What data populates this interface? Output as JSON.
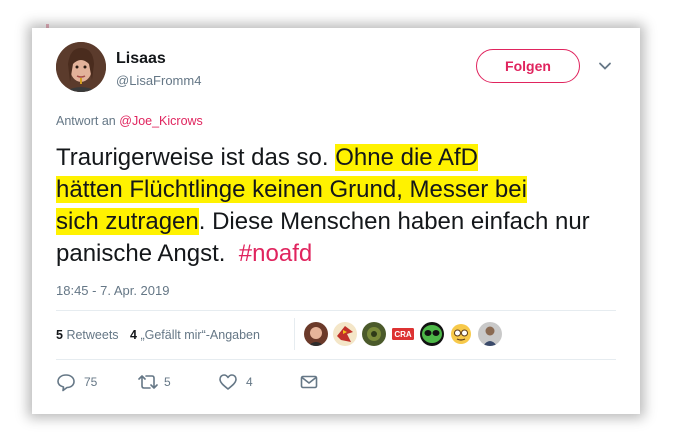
{
  "user": {
    "name": "Lisaas",
    "handle": "@LisaFromm4",
    "avatar_icon": "profile-photo"
  },
  "follow_label": "Folgen",
  "reply_context": {
    "prefix": "Antwort an",
    "mention": "@Joe_Kicrows"
  },
  "tweet": {
    "part1": "Traurigerweise ist das so.",
    "hl1": "Ohne die AfD",
    "hl2": "hätten Flüchtlinge keinen Grund, Messer bei",
    "hl3": "sich zutragen",
    "part2": ". Diese Menschen haben einfach nur panische Angst.",
    "hashtag": "#noafd"
  },
  "timestamp": "18:45 - 7. Apr. 2019",
  "stats": {
    "retweets_count": "5",
    "retweets_label": "Retweets",
    "likes_count": "4",
    "likes_label": "„Gefällt mir“-Angaben"
  },
  "likers": [
    {
      "icon": "liker-avatar-woman"
    },
    {
      "icon": "liker-avatar-eagle"
    },
    {
      "icon": "liker-avatar-green"
    },
    {
      "icon": "liker-avatar-crazy-text"
    },
    {
      "icon": "liker-avatar-alien-sunglasses"
    },
    {
      "icon": "liker-avatar-nerd-emoji"
    },
    {
      "icon": "liker-avatar-person"
    }
  ],
  "actions": {
    "reply_count": "75",
    "retweet_count": "5",
    "like_count": "4"
  },
  "colors": {
    "accent": "#e0245e",
    "highlight": "#fff200",
    "text": "#14171a",
    "muted": "#657786"
  }
}
